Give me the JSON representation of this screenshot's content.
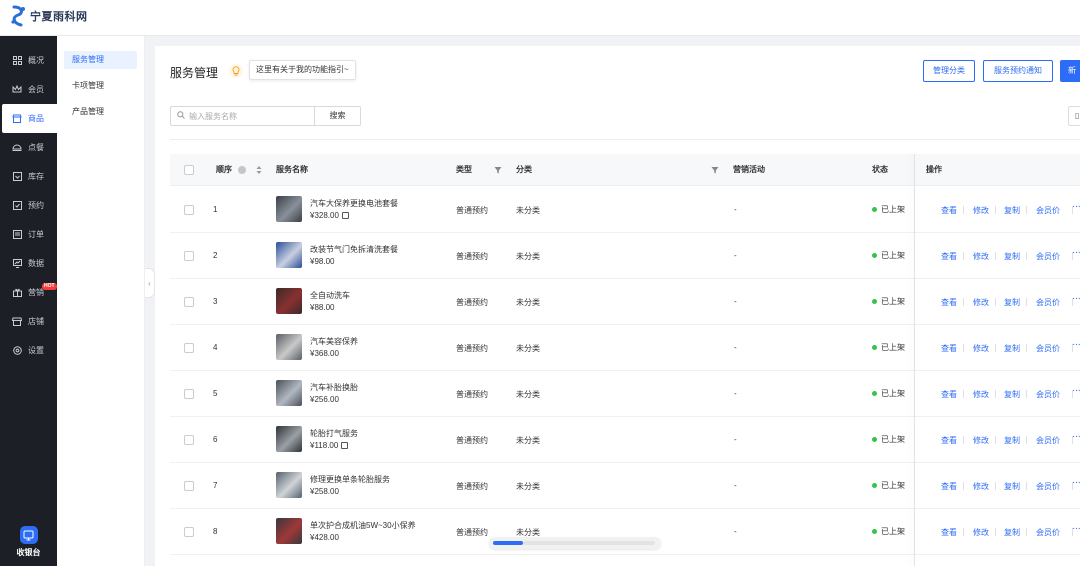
{
  "brand": {
    "name": "宁夏雨科网"
  },
  "sidebar": {
    "items": [
      {
        "label": "概况",
        "icon": "grid-icon"
      },
      {
        "label": "会员",
        "icon": "crown-icon"
      },
      {
        "label": "商品",
        "icon": "shop-icon"
      },
      {
        "label": "点餐",
        "icon": "dish-icon"
      },
      {
        "label": "库存",
        "icon": "box-icon"
      },
      {
        "label": "预约",
        "icon": "check-calendar-icon"
      },
      {
        "label": "订单",
        "icon": "order-icon"
      },
      {
        "label": "数据",
        "icon": "chart-icon"
      },
      {
        "label": "营销",
        "icon": "gift-icon",
        "badge": "HOT"
      },
      {
        "label": "店铺",
        "icon": "store-icon"
      },
      {
        "label": "设置",
        "icon": "gear-icon"
      }
    ],
    "active_index": 2,
    "cashier_label": "收银台"
  },
  "subnav": {
    "items": [
      {
        "label": "服务管理"
      },
      {
        "label": "卡项管理"
      },
      {
        "label": "产品管理"
      }
    ]
  },
  "header": {
    "title": "服务管理",
    "guide_text": "这里有关于我的功能指引~",
    "btn_category": "管理分类",
    "btn_notice": "服务预约通知",
    "btn_new": "新"
  },
  "search": {
    "placeholder": "输入服务名称",
    "button": "搜索"
  },
  "table": {
    "columns": {
      "order": "顺序",
      "name": "服务名称",
      "type": "类型",
      "category": "分类",
      "promo": "营销活动",
      "status": "状态",
      "actions": "操作"
    },
    "action_labels": {
      "view": "查看",
      "edit": "修改",
      "copy": "复制",
      "member_price": "会员价",
      "more": "···"
    },
    "rows": [
      {
        "order": "1",
        "name": "汽车大保养更换电池套餐",
        "price": "¥328.00",
        "tag": true,
        "type": "普通预约",
        "category": "未分类",
        "promo": "-",
        "status": "已上架"
      },
      {
        "order": "2",
        "name": "改装节气门免拆清洗套餐",
        "price": "¥98.00",
        "tag": false,
        "type": "普通预约",
        "category": "未分类",
        "promo": "-",
        "status": "已上架"
      },
      {
        "order": "3",
        "name": "全自动洗车",
        "price": "¥88.00",
        "tag": false,
        "type": "普通预约",
        "category": "未分类",
        "promo": "-",
        "status": "已上架"
      },
      {
        "order": "4",
        "name": "汽车美容保养",
        "price": "¥368.00",
        "tag": false,
        "type": "普通预约",
        "category": "未分类",
        "promo": "-",
        "status": "已上架"
      },
      {
        "order": "5",
        "name": "汽车补胎换胎",
        "price": "¥256.00",
        "tag": false,
        "type": "普通预约",
        "category": "未分类",
        "promo": "-",
        "status": "已上架"
      },
      {
        "order": "6",
        "name": "轮胎打气服务",
        "price": "¥118.00",
        "tag": true,
        "type": "普通预约",
        "category": "未分类",
        "promo": "-",
        "status": "已上架"
      },
      {
        "order": "7",
        "name": "修理更换单条轮胎服务",
        "price": "¥258.00",
        "tag": false,
        "type": "普通预约",
        "category": "未分类",
        "promo": "-",
        "status": "已上架"
      },
      {
        "order": "8",
        "name": "单次护合成机油5W~30小保养",
        "price": "¥428.00",
        "tag": false,
        "type": "普通预约",
        "category": "未分类",
        "promo": "-",
        "status": "已上架"
      }
    ]
  },
  "colors": {
    "accent": "#2c6cf6",
    "sidebar_bg": "#1c1f26",
    "status_green": "#37c24b",
    "hot_red": "#f53d3d"
  },
  "scroll": {
    "horizontal_position": 0.18
  }
}
